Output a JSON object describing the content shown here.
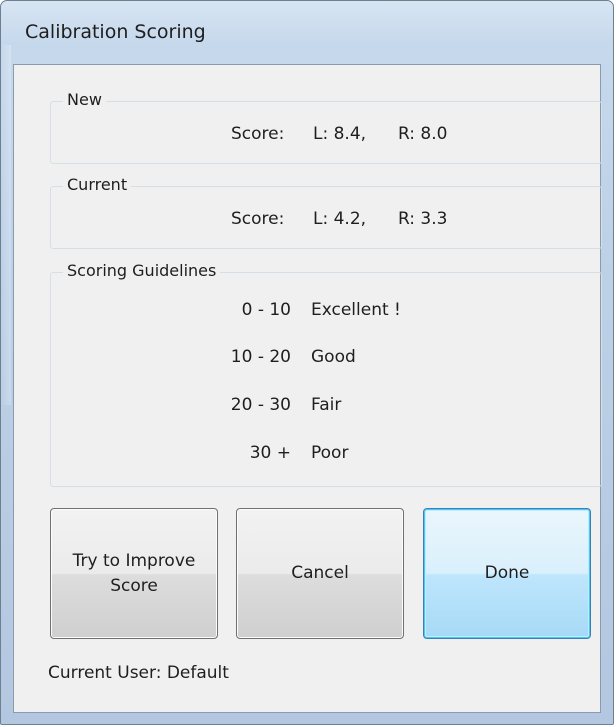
{
  "window": {
    "title": "Calibration Scoring"
  },
  "new_group": {
    "label": "New",
    "score_label": "Score:",
    "left": "L: 8.4,",
    "right": "R: 8.0"
  },
  "current_group": {
    "label": "Current",
    "score_label": "Score:",
    "left": "L: 4.2,",
    "right": "R: 3.3"
  },
  "guidelines": {
    "label": "Scoring Guidelines",
    "rows": [
      {
        "range": "0 - 10",
        "description": "Excellent !"
      },
      {
        "range": "10 - 20",
        "description": "Good"
      },
      {
        "range": "20 - 30",
        "description": "Fair"
      },
      {
        "range": "30 +",
        "description": "Poor"
      }
    ]
  },
  "buttons": {
    "improve": "Try to Improve Score",
    "cancel": "Cancel",
    "done": "Done"
  },
  "footer": {
    "current_user": "Current User: Default"
  },
  "colors": {
    "frame": "#bcd0e6",
    "client_background": "#f0f0f0",
    "default_button_border": "#3c7fb1"
  }
}
